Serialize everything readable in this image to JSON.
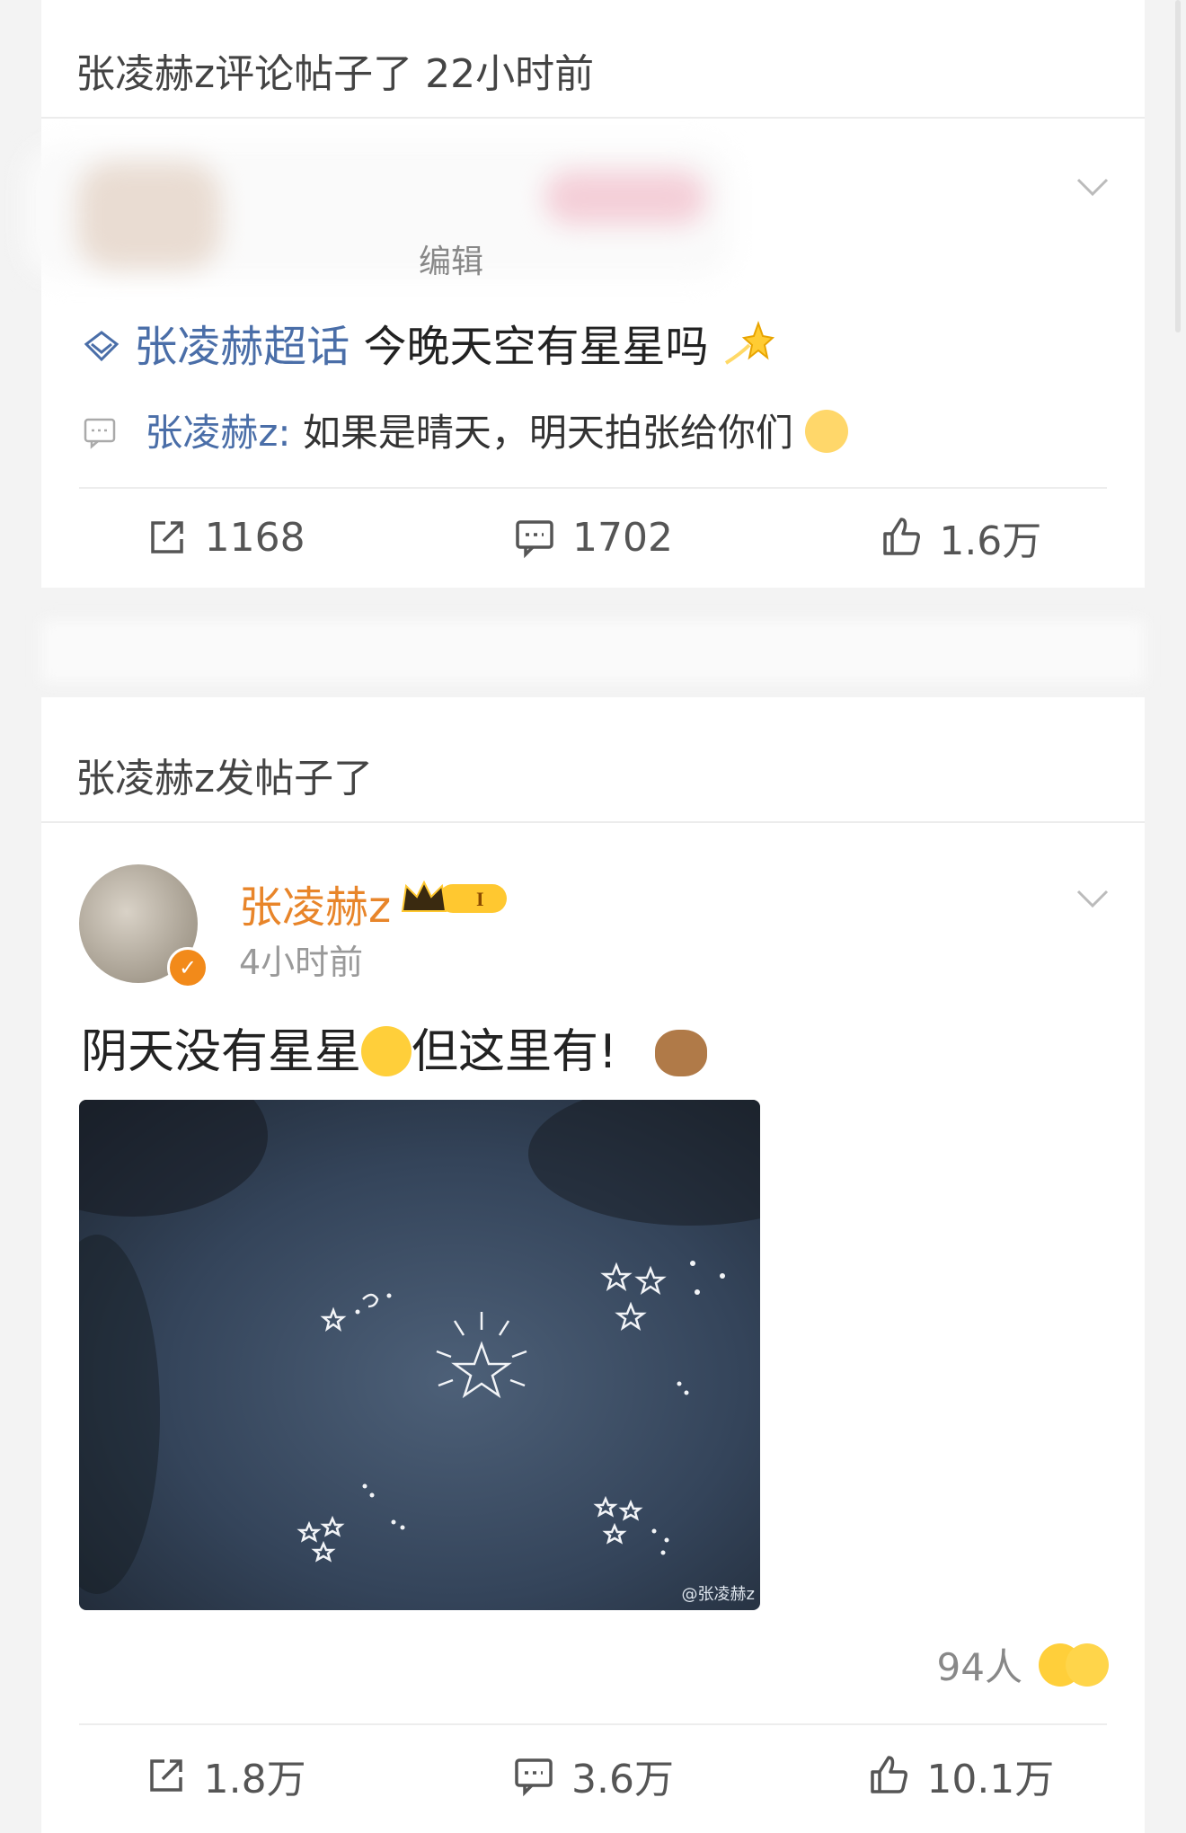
{
  "post1": {
    "activity_user": "张凌赫z",
    "activity_action": "评论帖子了",
    "activity_time": "22小时前",
    "author_edited": "编辑",
    "super_topic": "张凌赫超话",
    "post_text": "今晚天空有星星吗",
    "comment_user": "张凌赫z:",
    "comment_text": "如果是晴天，明天拍张给你们",
    "actions": {
      "repost": "1168",
      "comment": "1702",
      "like": "1.6万"
    }
  },
  "post2": {
    "activity_user": "张凌赫z",
    "activity_action": "发帖子了",
    "author_name": "张凌赫z",
    "level": "I",
    "time": "4小时前",
    "text_part1": "阴天没有星星",
    "text_part2": "但这里有!",
    "image_watermark": "@张凌赫z",
    "likers_count": "94人",
    "actions": {
      "repost": "1.8万",
      "comment": "3.6万",
      "like": "10.1万"
    }
  },
  "colors": {
    "link": "#4a6ea8",
    "vip_name": "#e8852a",
    "badge": "#f28a1a"
  },
  "icons": [
    "repost-icon",
    "comment-icon",
    "like-icon",
    "chevron-down-icon",
    "super-topic-icon",
    "comment-bubble-icon",
    "vip-crown-icon",
    "verified-icon",
    "sparkle-star-emoji",
    "laugh-cry-emoji",
    "capybara-emoji",
    "face-emoji"
  ]
}
